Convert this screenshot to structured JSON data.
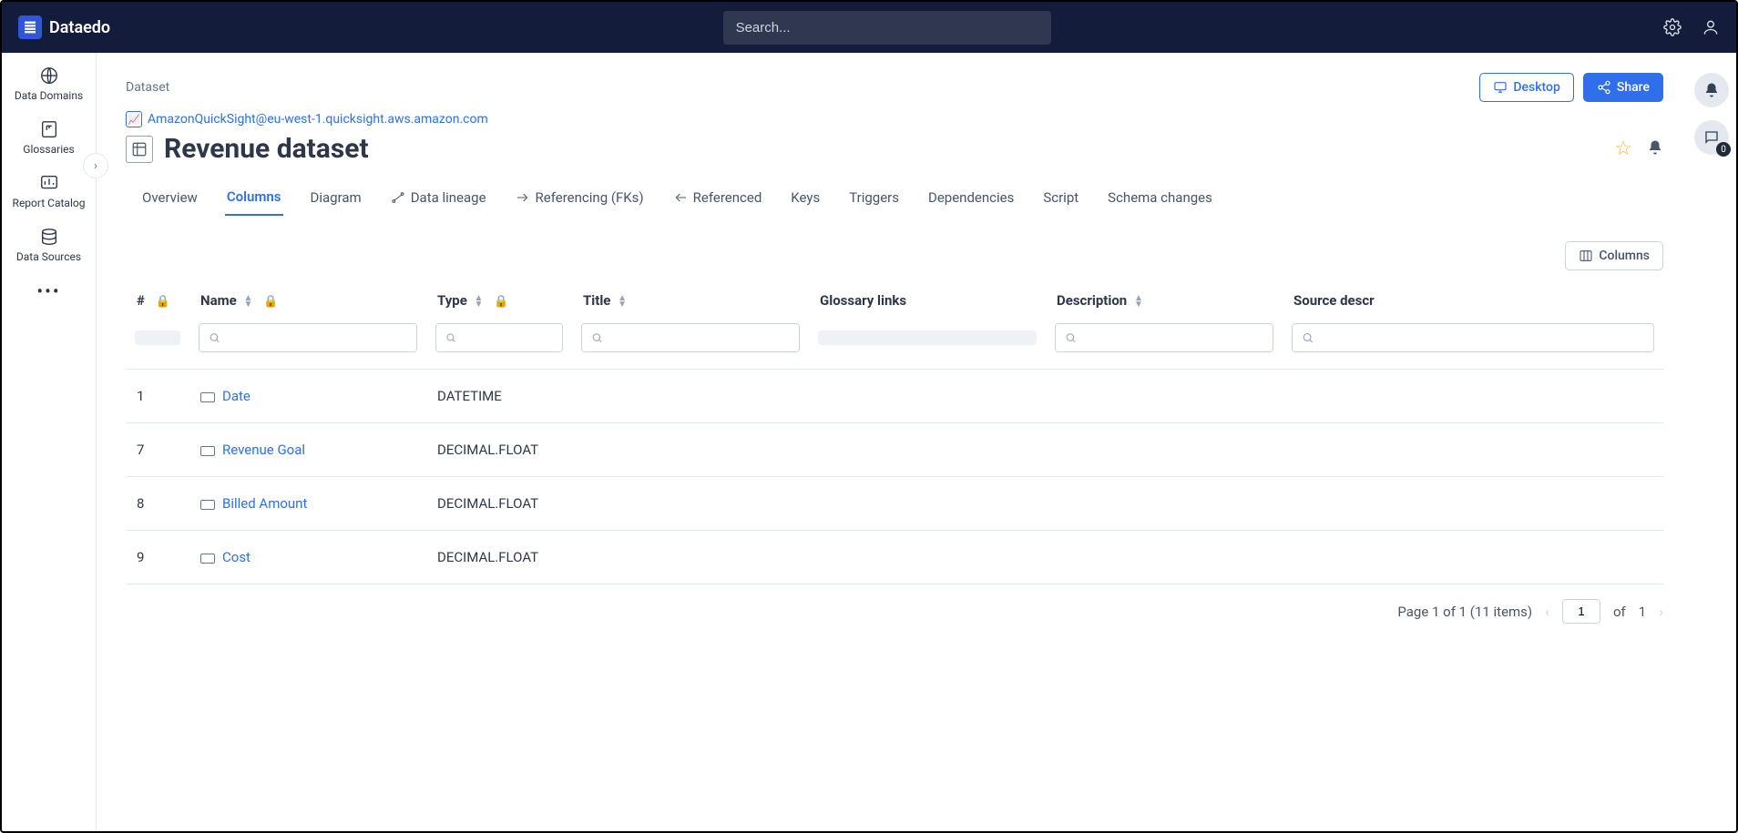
{
  "brand": "Dataedo",
  "search": {
    "placeholder": "Search..."
  },
  "sidebar": {
    "items": [
      {
        "label": "Data Domains"
      },
      {
        "label": "Glossaries"
      },
      {
        "label": "Report Catalog"
      },
      {
        "label": "Data Sources"
      }
    ]
  },
  "breadcrumb": "Dataset",
  "buttons": {
    "desktop": "Desktop",
    "share": "Share",
    "columns": "Columns"
  },
  "source": {
    "text": "AmazonQuickSight@eu-west-1.quicksight.aws.amazon.com"
  },
  "page_title": "Revenue dataset",
  "tabs": [
    "Overview",
    "Columns",
    "Diagram",
    "Data lineage",
    "Referencing (FKs)",
    "Referenced",
    "Keys",
    "Triggers",
    "Dependencies",
    "Script",
    "Schema changes"
  ],
  "active_tab": "Columns",
  "columns": {
    "headers": [
      "#",
      "Name",
      "Type",
      "Title",
      "Glossary links",
      "Description",
      "Source descr"
    ],
    "rows": [
      {
        "num": "1",
        "name": "Date",
        "type": "DATETIME"
      },
      {
        "num": "7",
        "name": "Revenue Goal",
        "type": "DECIMAL.FLOAT"
      },
      {
        "num": "8",
        "name": "Billed Amount",
        "type": "DECIMAL.FLOAT"
      },
      {
        "num": "9",
        "name": "Cost",
        "type": "DECIMAL.FLOAT"
      }
    ]
  },
  "pagination": {
    "status": "Page 1 of 1 (11 items)",
    "page": "1",
    "of": "of",
    "total": "1"
  },
  "chat_badge": "0"
}
